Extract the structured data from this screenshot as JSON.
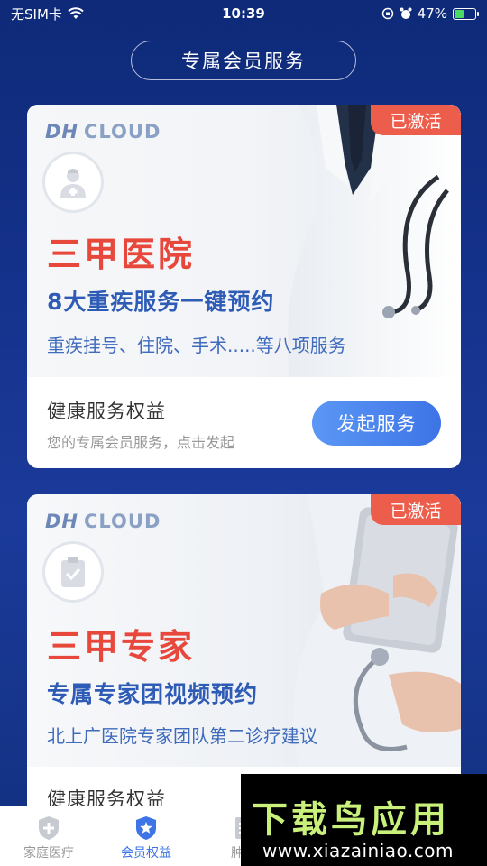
{
  "status_bar": {
    "carrier": "无SIM卡",
    "time": "10:39",
    "battery": "47%",
    "battery_level": 0.47
  },
  "header": {
    "title": "专属会员服务"
  },
  "cards": [
    {
      "brand": "CLOUD",
      "badge": "已激活",
      "title": "三甲医院",
      "subtitle": "8大重疾服务一键预约",
      "description": "重疾挂号、住院、手术.....等八项服务",
      "footer_title": "健康服务权益",
      "footer_desc": "您的专属会员服务，点击发起",
      "action": "发起服务",
      "avatar_icon": "doctor-icon"
    },
    {
      "brand": "CLOUD",
      "badge": "已激活",
      "title": "三甲专家",
      "subtitle": "专属专家团视频预约",
      "description": "北上广医院专家团队第二诊疗建议",
      "footer_title": "健康服务权益",
      "avatar_icon": "clipboard-icon"
    }
  ],
  "tabbar": {
    "tabs": [
      {
        "label": "家庭医疗",
        "icon": "shield-plus-icon",
        "active": false
      },
      {
        "label": "会员权益",
        "icon": "shield-star-icon",
        "active": true
      },
      {
        "label": "肿瘤",
        "icon": "document-icon",
        "active": false
      }
    ]
  },
  "watermark": {
    "title": "下载鸟应用",
    "url": "www.xiazainiao.com"
  },
  "colors": {
    "accent": "#3d74e6",
    "badge": "#ec5d4c",
    "title_red": "#e8473b",
    "subtitle_blue": "#2d5bb6"
  }
}
